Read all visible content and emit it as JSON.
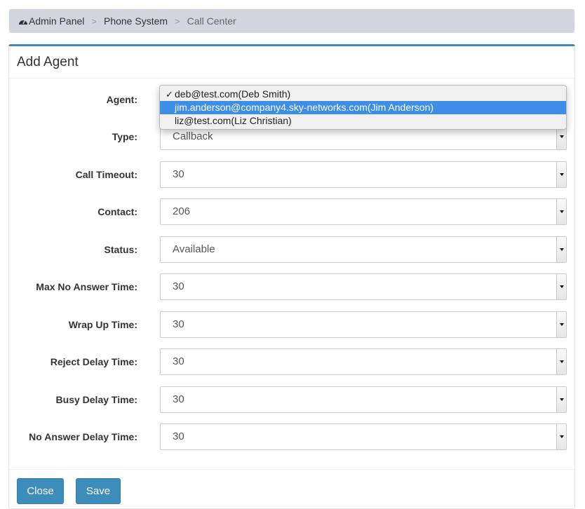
{
  "breadcrumb": {
    "icon": "dashboard-icon",
    "items": [
      "Admin Panel",
      "Phone System",
      "Call Center"
    ],
    "separator": ">"
  },
  "panel": {
    "title": "Add Agent"
  },
  "agent_dropdown": {
    "options": [
      "deb@test.com(Deb Smith)",
      "jim.anderson@company4.sky-networks.com(Jim Anderson)",
      "liz@test.com(Liz Christian)"
    ],
    "checked_index": 0,
    "highlighted_index": 1,
    "check_glyph": "✓"
  },
  "form": {
    "agent_label": "Agent:",
    "fields": [
      {
        "label": "Type:",
        "value": "Callback"
      },
      {
        "label": "Call Timeout:",
        "value": "30"
      },
      {
        "label": "Contact:",
        "value": "206"
      },
      {
        "label": "Status:",
        "value": "Available"
      },
      {
        "label": "Max No Answer Time:",
        "value": "30"
      },
      {
        "label": "Wrap Up Time:",
        "value": "30"
      },
      {
        "label": "Reject Delay Time:",
        "value": "30"
      },
      {
        "label": "Busy Delay Time:",
        "value": "30"
      },
      {
        "label": "No Answer Delay Time:",
        "value": "30"
      }
    ]
  },
  "buttons": {
    "close": "Close",
    "save": "Save"
  },
  "colors": {
    "primary": "#3c8dbc",
    "highlight": "#3d8ee6",
    "breadcrumb_bg": "#d2d6de"
  }
}
